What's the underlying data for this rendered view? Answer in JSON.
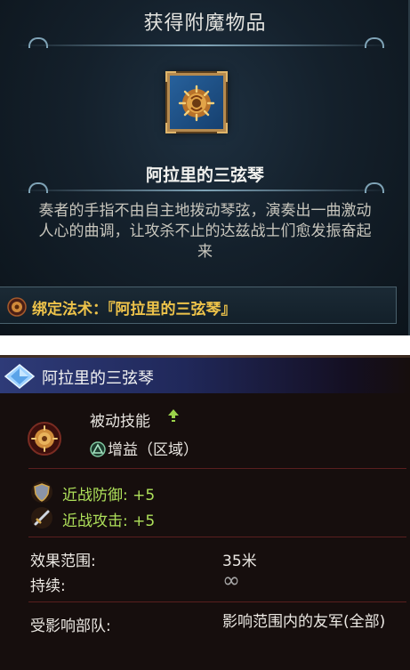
{
  "dialog": {
    "title": "获得附魔物品",
    "item_name": "阿拉里的三弦琴",
    "description_lines": [
      "奏者的手指不由自主地拨动琴弦，演奏出一曲激动",
      "人心的曲调，让攻杀不止的达兹战士们愈发振奋起",
      "来"
    ],
    "bound_spell_label": "绑定法术：",
    "bound_spell_value": "『阿拉里的三弦琴』"
  },
  "tooltip": {
    "title": "阿拉里的三弦琴",
    "skill_type": "被动技能",
    "buff_label": "增益（区域）",
    "stats": [
      {
        "label": "近战防御: +5",
        "icon": "shield-icon"
      },
      {
        "label": "近战攻击: +5",
        "icon": "sword-icon"
      }
    ],
    "range_label": "效果范围:",
    "range_value": "35米",
    "duration_label": "持续:",
    "duration_value": "∞",
    "affected_label": "受影响部队:",
    "affected_value": "影响范围内的友军(全部)"
  },
  "icons": [
    "lyre-icon",
    "spell-icon",
    "crystal-icon",
    "up-arrow-icon",
    "buff-icon",
    "shield-icon",
    "sword-icon"
  ],
  "colors": {
    "accent_gold": "#eec34a",
    "stat_green": "#aee05a",
    "header_blue": "#2e3b78"
  }
}
